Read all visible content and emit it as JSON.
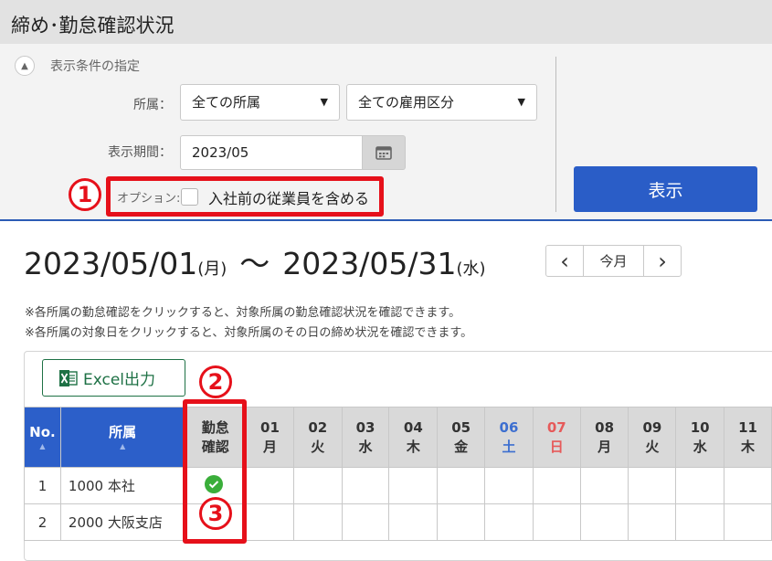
{
  "header": {
    "title": "締め･勤怠確認状況"
  },
  "filter": {
    "title": "表示条件の指定",
    "collapse_icon": "chevron-up-icon",
    "dept_label": "所属：",
    "dept_select": "全ての所属",
    "employment_select": "全ての雇用区分",
    "period_label": "表示期間：",
    "period_value": "2023/05",
    "option_label": "オプション:",
    "option_checkbox_label": "入社前の従業員を含める",
    "show_button": "表示"
  },
  "callouts": {
    "one": "1",
    "two": "2",
    "three": "3"
  },
  "period": {
    "start": "2023/05/01",
    "start_dow": "(月)",
    "tilde": "～",
    "end": "2023/05/31",
    "end_dow": "(水)"
  },
  "nav": {
    "prev": "‹",
    "today": "今月",
    "next": "›"
  },
  "notes": [
    "※各所属の勤怠確認をクリックすると、対象所属の勤怠確認状況を確認できます。",
    "※各所属の対象日をクリックすると、対象所属のその日の締め状況を確認できます。"
  ],
  "excel_button": "Excel出力",
  "table": {
    "headers": {
      "no": "No.",
      "dept": "所属",
      "confirm_line1": "勤怠",
      "confirm_line2": "確認",
      "days": [
        {
          "day": "01",
          "dow": "月"
        },
        {
          "day": "02",
          "dow": "火"
        },
        {
          "day": "03",
          "dow": "水"
        },
        {
          "day": "04",
          "dow": "木"
        },
        {
          "day": "05",
          "dow": "金"
        },
        {
          "day": "06",
          "dow": "土"
        },
        {
          "day": "07",
          "dow": "日"
        },
        {
          "day": "08",
          "dow": "月"
        },
        {
          "day": "09",
          "dow": "火"
        },
        {
          "day": "10",
          "dow": "水"
        },
        {
          "day": "11",
          "dow": "木"
        }
      ]
    },
    "rows": [
      {
        "no": "1",
        "dept": "1000 本社",
        "confirmed": true
      },
      {
        "no": "2",
        "dept": "2000 大阪支店",
        "confirmed": false
      }
    ]
  },
  "colors": {
    "accent": "#2a5dc7",
    "highlight": "#e6101a",
    "excel": "#1e7145",
    "saturday": "#3d6fd0",
    "sunday": "#e65a5a",
    "check": "#3aae3a"
  }
}
